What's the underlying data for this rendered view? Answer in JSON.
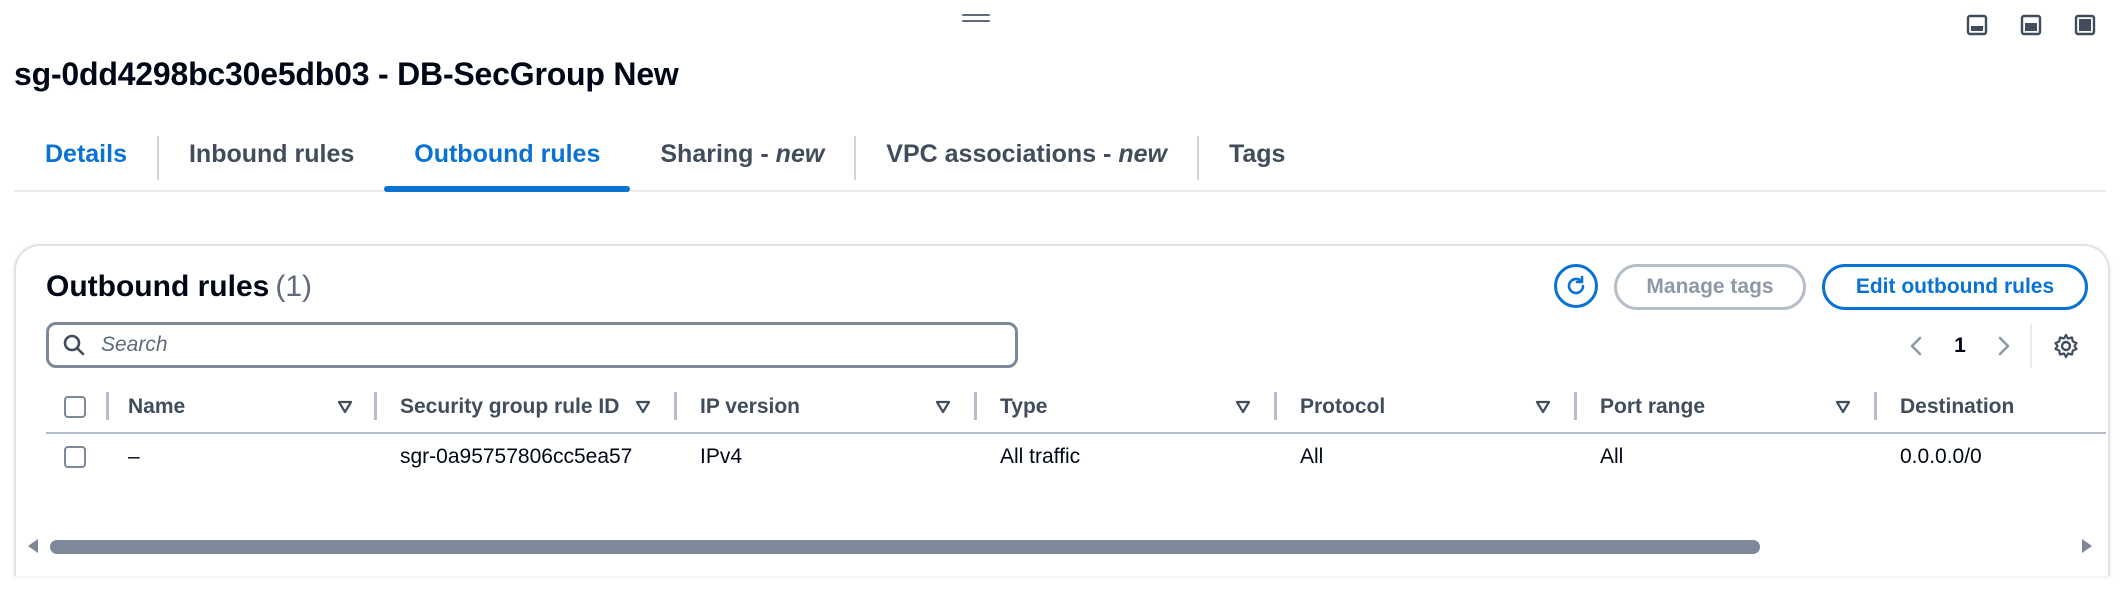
{
  "page": {
    "title": "sg-0dd4298bc30e5db03 - DB-SecGroup New"
  },
  "view_icons": [
    "split-bottom-icon",
    "split-side-icon",
    "full-view-icon"
  ],
  "tabs": [
    {
      "label": "Details",
      "suffix": ""
    },
    {
      "label": "Inbound rules",
      "suffix": ""
    },
    {
      "label": "Outbound rules",
      "suffix": ""
    },
    {
      "label": "Sharing - ",
      "suffix": "new"
    },
    {
      "label": "VPC associations - ",
      "suffix": "new"
    },
    {
      "label": "Tags",
      "suffix": ""
    }
  ],
  "active_tab": "Outbound rules",
  "panel": {
    "title": "Outbound rules",
    "count": "(1)",
    "manage_tags_label": "Manage tags",
    "edit_label": "Edit outbound rules"
  },
  "search": {
    "placeholder": "Search",
    "value": ""
  },
  "pagination": {
    "current_page": "1"
  },
  "table": {
    "columns": [
      "Name",
      "Security group rule ID",
      "IP version",
      "Type",
      "Protocol",
      "Port range",
      "Destination"
    ],
    "rows": [
      {
        "name": "–",
        "rule_id": "sgr-0a95757806cc5ea57",
        "ip_version": "IPv4",
        "type": "All traffic",
        "protocol": "All",
        "port_range": "All",
        "destination": "0.0.0.0/0"
      }
    ]
  },
  "colors": {
    "accent": "#0972d3",
    "text": "#000716",
    "muted": "#5f6b7a",
    "disabled": "#8d99a8"
  }
}
